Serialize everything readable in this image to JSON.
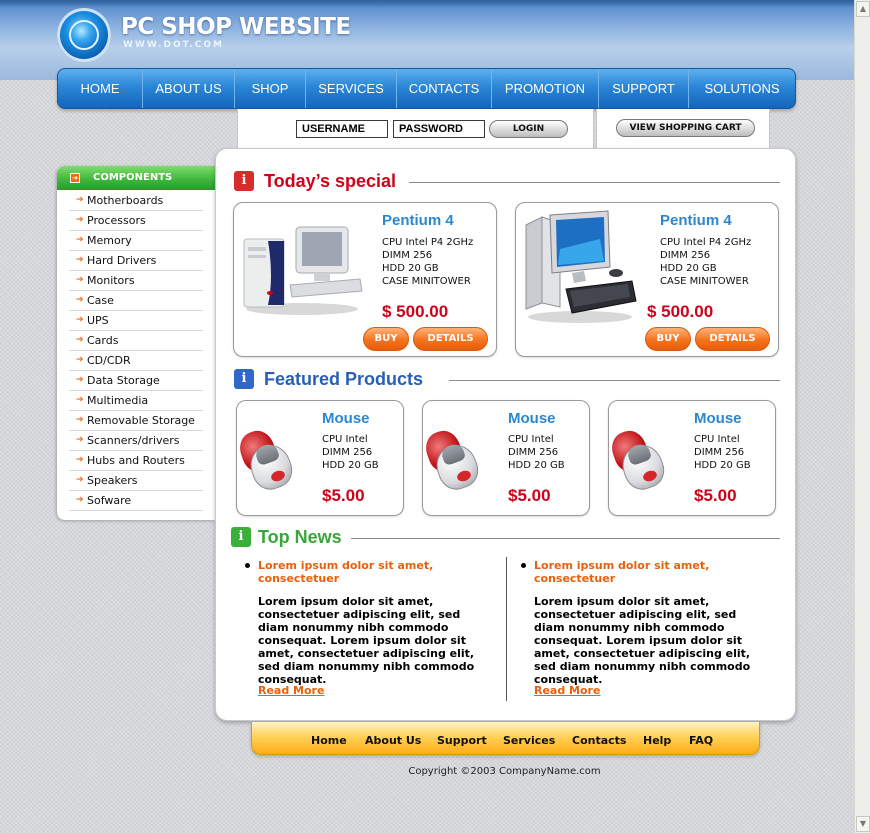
{
  "header": {
    "title": "PC SHOP WEBSITE",
    "url": "WWW.DOT.COM"
  },
  "nav": {
    "items": [
      {
        "label": "HOME"
      },
      {
        "label": "ABOUT US"
      },
      {
        "label": "SHOP"
      },
      {
        "label": "SERVICES"
      },
      {
        "label": "CONTACTS"
      },
      {
        "label": "PROMOTION"
      },
      {
        "label": "SUPPORT"
      },
      {
        "label": "SOLUTIONS"
      }
    ]
  },
  "login": {
    "username_placeholder": "USERNAME",
    "password_placeholder": "PASSWORD",
    "login_label": "LOGIN",
    "cart_label": "VIEW SHOPPING CART"
  },
  "sidebar": {
    "title": "COMPONENTS",
    "items": [
      {
        "label": "Motherboards"
      },
      {
        "label": "Processors"
      },
      {
        "label": "Memory"
      },
      {
        "label": "Hard Drivers"
      },
      {
        "label": "Monitors"
      },
      {
        "label": "Case"
      },
      {
        "label": "UPS"
      },
      {
        "label": "Cards"
      },
      {
        "label": "CD/CDR"
      },
      {
        "label": "Data Storage"
      },
      {
        "label": "Multimedia"
      },
      {
        "label": "Removable Storage"
      },
      {
        "label": "Scanners/drivers"
      },
      {
        "label": "Hubs and Routers"
      },
      {
        "label": "Speakers"
      },
      {
        "label": "Sofware"
      }
    ]
  },
  "specials": {
    "icon": "i",
    "title": "Today’s special",
    "title_color": "#d0021b",
    "icon_color": "#d92b2b",
    "items": [
      {
        "name": "Pentium 4",
        "specs": [
          "CPU Intel P4 2GHz",
          "DIMM 256",
          "HDD 20 GB",
          "CASE MINITOWER"
        ],
        "price": "$ 500.00",
        "buy_label": "BUY",
        "details_label": "DETAILS"
      },
      {
        "name": "Pentium 4",
        "specs": [
          "CPU Intel P4 2GHz",
          "DIMM 256",
          "HDD 20 GB",
          "CASE MINITOWER"
        ],
        "price": "$ 500.00",
        "buy_label": "BUY",
        "details_label": "DETAILS"
      }
    ]
  },
  "featured": {
    "icon": "i",
    "title": "Featured Products",
    "title_color": "#2860b8",
    "icon_color": "#2f68c6",
    "items": [
      {
        "name": "Mouse",
        "specs": [
          "CPU Intel",
          "DIMM 256",
          "HDD 20 GB"
        ],
        "price": "$5.00"
      },
      {
        "name": "Mouse",
        "specs": [
          "CPU Intel",
          "DIMM 256",
          "HDD 20 GB"
        ],
        "price": "$5.00"
      },
      {
        "name": "Mouse",
        "specs": [
          "CPU Intel",
          "DIMM 256",
          "HDD 20 GB"
        ],
        "price": "$5.00"
      }
    ]
  },
  "news": {
    "icon": "i",
    "title": "Top News",
    "title_color": "#3aa53a",
    "icon_color": "#3ab03a",
    "items": [
      {
        "headline": "Lorem ipsum dolor sit amet, consectetuer",
        "body": "Lorem ipsum dolor sit amet, consectetuer adipiscing elit, sed diam nonummy nibh commodo consequat. Lorem ipsum dolor sit amet, consectetuer adipiscing elit, sed diam nonummy nibh commodo consequat.",
        "more": "Read More"
      },
      {
        "headline": "Lorem ipsum dolor sit amet, consectetuer",
        "body": "Lorem ipsum dolor sit amet, consectetuer adipiscing elit, sed diam nonummy nibh commodo consequat. Lorem ipsum dolor sit amet, consectetuer adipiscing elit, sed diam nonummy nibh commodo consequat.",
        "more": "Read More"
      }
    ]
  },
  "footer": {
    "links": [
      {
        "label": "Home"
      },
      {
        "label": "About Us"
      },
      {
        "label": "Support"
      },
      {
        "label": "Services"
      },
      {
        "label": "Contacts"
      },
      {
        "label": "Help"
      },
      {
        "label": "FAQ"
      }
    ],
    "copyright": "Copyright ©2003 CompanyName.com"
  },
  "colors": {
    "accent_orange": "#f5731c",
    "nav_blue": "#2b86d6",
    "price_red": "#d0021b",
    "product_name_blue": "#2b87cf"
  }
}
